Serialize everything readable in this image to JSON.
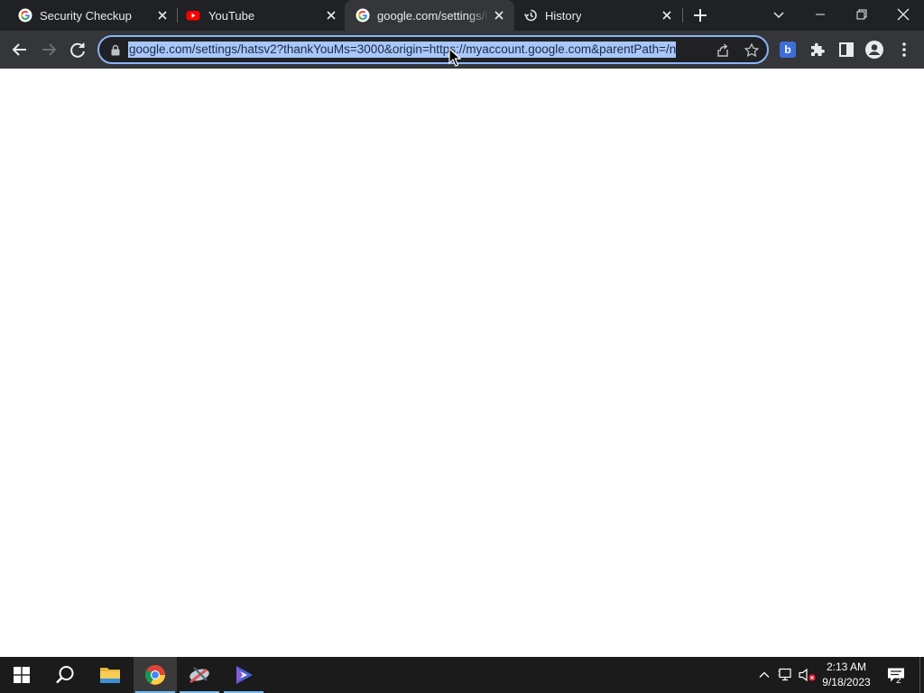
{
  "tabs": [
    {
      "title": "Security Checkup",
      "favicon": "google-g-icon",
      "active": false
    },
    {
      "title": "YouTube",
      "favicon": "youtube-icon",
      "active": false
    },
    {
      "title": "google.com/settings/h",
      "favicon": "google-g-icon",
      "active": true
    },
    {
      "title": "History",
      "favicon": "history-icon",
      "active": false
    }
  ],
  "omnibox": {
    "url": "google.com/settings/hatsv2?thankYouMs=3000&origin=https://myaccount.google.com&parentPath=/n",
    "selected": true
  },
  "extensions": {
    "b_label": "b"
  },
  "taskbar": {
    "apps": [
      "start-icon",
      "search-icon",
      "file-explorer-icon",
      "chrome-icon",
      "snipping-tool-icon",
      "video-editor-icon"
    ],
    "active_app": "chrome-icon"
  },
  "tray": {
    "time": "2:13 AM",
    "date": "9/18/2023",
    "notification_count": "2"
  },
  "colors": {
    "tabstrip_bg": "#202124",
    "toolbar_bg": "#35363a",
    "selection": "#a8c7fa",
    "omnibox_border": "#8ab4f8",
    "taskbar_bg": "#1b1b1b"
  }
}
